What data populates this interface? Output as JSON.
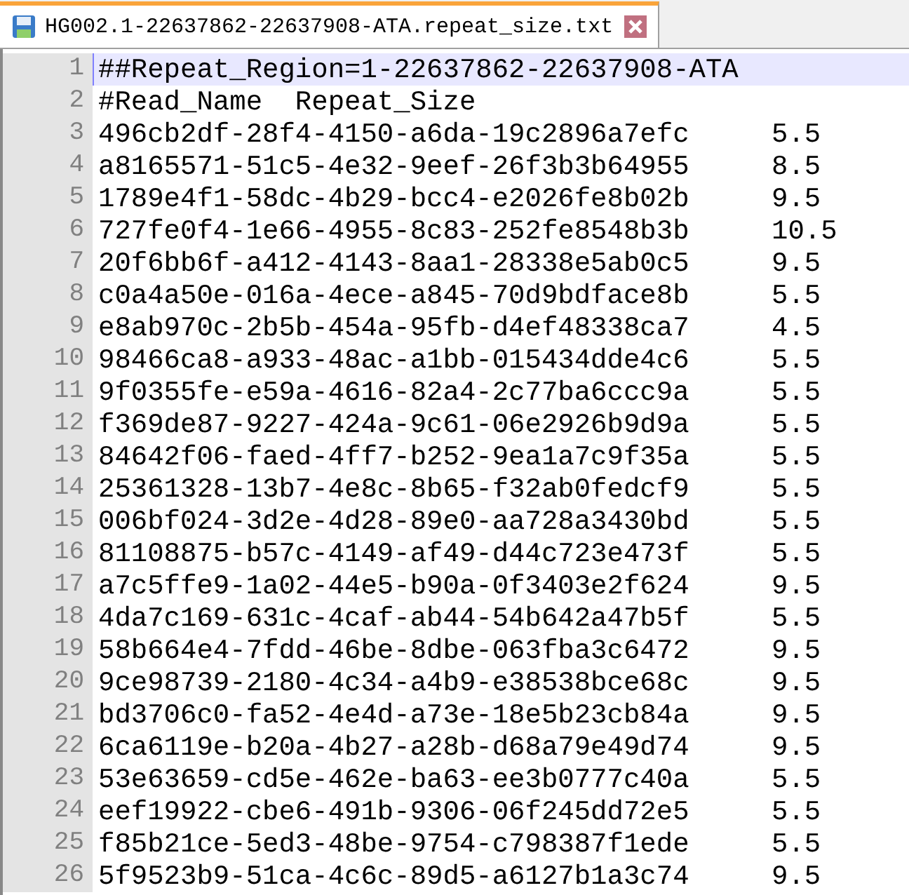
{
  "tab": {
    "title": "HG002.1-22637862-22637908-ATA.repeat_size.txt",
    "selected": true
  },
  "lines": [
    {
      "number": "1",
      "kind": "text",
      "text": "##Repeat_Region=1-22637862-22637908-ATA",
      "current": true
    },
    {
      "number": "2",
      "kind": "text",
      "text": "#Read_Name  Repeat_Size",
      "current": false
    },
    {
      "number": "3",
      "kind": "record",
      "name": "496cb2df-28f4-4150-a6da-19c2896a7efc",
      "size": "5.5",
      "current": false
    },
    {
      "number": "4",
      "kind": "record",
      "name": "a8165571-51c5-4e32-9eef-26f3b3b64955",
      "size": "8.5",
      "current": false
    },
    {
      "number": "5",
      "kind": "record",
      "name": "1789e4f1-58dc-4b29-bcc4-e2026fe8b02b",
      "size": "9.5",
      "current": false
    },
    {
      "number": "6",
      "kind": "record",
      "name": "727fe0f4-1e66-4955-8c83-252fe8548b3b",
      "size": "10.5",
      "current": false
    },
    {
      "number": "7",
      "kind": "record",
      "name": "20f6bb6f-a412-4143-8aa1-28338e5ab0c5",
      "size": "9.5",
      "current": false
    },
    {
      "number": "8",
      "kind": "record",
      "name": "c0a4a50e-016a-4ece-a845-70d9bdface8b",
      "size": "5.5",
      "current": false
    },
    {
      "number": "9",
      "kind": "record",
      "name": "e8ab970c-2b5b-454a-95fb-d4ef48338ca7",
      "size": "4.5",
      "current": false
    },
    {
      "number": "10",
      "kind": "record",
      "name": "98466ca8-a933-48ac-a1bb-015434dde4c6",
      "size": "5.5",
      "current": false
    },
    {
      "number": "11",
      "kind": "record",
      "name": "9f0355fe-e59a-4616-82a4-2c77ba6ccc9a",
      "size": "5.5",
      "current": false
    },
    {
      "number": "12",
      "kind": "record",
      "name": "f369de87-9227-424a-9c61-06e2926b9d9a",
      "size": "5.5",
      "current": false
    },
    {
      "number": "13",
      "kind": "record",
      "name": "84642f06-faed-4ff7-b252-9ea1a7c9f35a",
      "size": "5.5",
      "current": false
    },
    {
      "number": "14",
      "kind": "record",
      "name": "25361328-13b7-4e8c-8b65-f32ab0fedcf9",
      "size": "5.5",
      "current": false
    },
    {
      "number": "15",
      "kind": "record",
      "name": "006bf024-3d2e-4d28-89e0-aa728a3430bd",
      "size": "5.5",
      "current": false
    },
    {
      "number": "16",
      "kind": "record",
      "name": "81108875-b57c-4149-af49-d44c723e473f",
      "size": "5.5",
      "current": false
    },
    {
      "number": "17",
      "kind": "record",
      "name": "a7c5ffe9-1a02-44e5-b90a-0f3403e2f624",
      "size": "9.5",
      "current": false
    },
    {
      "number": "18",
      "kind": "record",
      "name": "4da7c169-631c-4caf-ab44-54b642a47b5f",
      "size": "5.5",
      "current": false
    },
    {
      "number": "19",
      "kind": "record",
      "name": "58b664e4-7fdd-46be-8dbe-063fba3c6472",
      "size": "9.5",
      "current": false
    },
    {
      "number": "20",
      "kind": "record",
      "name": "9ce98739-2180-4c34-a4b9-e38538bce68c",
      "size": "9.5",
      "current": false
    },
    {
      "number": "21",
      "kind": "record",
      "name": "bd3706c0-fa52-4e4d-a73e-18e5b23cb84a",
      "size": "9.5",
      "current": false
    },
    {
      "number": "22",
      "kind": "record",
      "name": "6ca6119e-b20a-4b27-a28b-d68a79e49d74",
      "size": "9.5",
      "current": false
    },
    {
      "number": "23",
      "kind": "record",
      "name": "53e63659-cd5e-462e-ba63-ee3b0777c40a",
      "size": "5.5",
      "current": false
    },
    {
      "number": "24",
      "kind": "record",
      "name": "eef19922-cbe6-491b-9306-06f245dd72e5",
      "size": "5.5",
      "current": false
    },
    {
      "number": "25",
      "kind": "record",
      "name": "f85b21ce-5ed3-48be-9754-c798387f1ede",
      "size": "5.5",
      "current": false
    },
    {
      "number": "26",
      "kind": "record",
      "name": "5f9523b9-51ca-4c6c-89d5-a6127b1a3c74",
      "size": "9.5",
      "current": false
    }
  ]
}
